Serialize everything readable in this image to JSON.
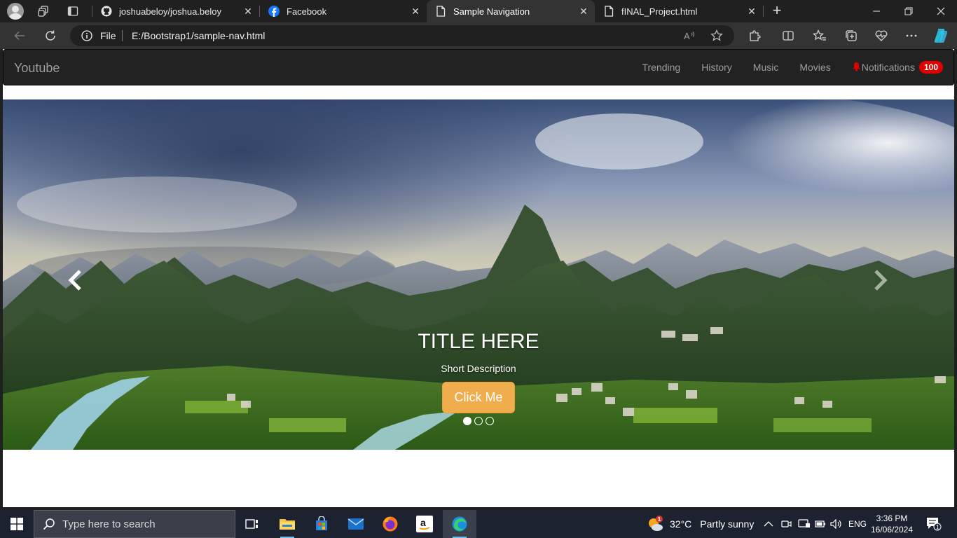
{
  "browser": {
    "tabs": [
      {
        "title": "joshuabeloy/joshua.beloy",
        "favicon": "github-icon",
        "active": false
      },
      {
        "title": "Facebook",
        "favicon": "facebook-icon",
        "active": false
      },
      {
        "title": "Sample Navigation",
        "favicon": "file-icon",
        "active": true
      },
      {
        "title": "fINAL_Project.html",
        "favicon": "file-icon",
        "active": false
      }
    ],
    "address": {
      "scheme_label": "File",
      "url": "E:/Bootstrap1/sample-nav.html"
    }
  },
  "page": {
    "brand": "Youtube",
    "nav": [
      {
        "label": "Trending"
      },
      {
        "label": "History"
      },
      {
        "label": "Music"
      },
      {
        "label": "Movies"
      }
    ],
    "notifications": {
      "label": "Notifications",
      "count": "100"
    },
    "carousel": {
      "title": "TITLE HERE",
      "description": "Short Description",
      "button": "Click Me",
      "slide_count": 3,
      "active_slide": 1
    },
    "colors": {
      "navbar_bg": "#222222",
      "nav_text": "#9d9d9d",
      "badge": "#e00000",
      "button": "#f0ad4e"
    }
  },
  "taskbar": {
    "search_placeholder": "Type here to search",
    "weather": {
      "temp": "32°C",
      "condition": "Partly sunny",
      "alert_count": "1"
    },
    "language": "ENG",
    "time": "3:36 PM",
    "date": "16/06/2024",
    "notification_count": "1"
  }
}
